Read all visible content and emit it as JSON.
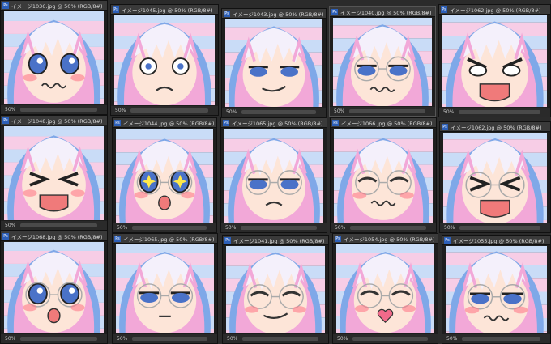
{
  "app": {
    "name": "image editor workspace"
  },
  "windows": [
    {
      "title": "イメージ1036.jpg @ 50% (RGB/8#)",
      "zoom": "50%",
      "expression": "flustered-crying",
      "active": false
    },
    {
      "title": "イメージ1045.jpg @ 50% (RGB/8#)",
      "zoom": "50%",
      "expression": "shocked",
      "active": false
    },
    {
      "title": "イメージ1043.jpg @ 50% (RGB/8#)",
      "zoom": "50%",
      "expression": "smug",
      "active": false
    },
    {
      "title": "イメージ1040.jpg @ 50% (RGB/8#)",
      "zoom": "50%",
      "expression": "nervous",
      "active": true
    },
    {
      "title": "イメージ1062.jpg @ 50% (RGB/8#)",
      "zoom": "50%",
      "expression": "angry",
      "active": false
    },
    {
      "title": "イメージ1048.jpg @ 50% (RGB/8#)",
      "zoom": "50%",
      "expression": "embarrassed-shout",
      "active": false
    },
    {
      "title": "イメージ1044.jpg @ 50% (RGB/8#)",
      "zoom": "50%",
      "expression": "sparkle-eyes",
      "active": false
    },
    {
      "title": "イメージ1065.jpg @ 50% (RGB/8#)",
      "zoom": "50%",
      "expression": "annoyed",
      "active": false
    },
    {
      "title": "イメージ1066.jpg @ 50% (RGB/8#)",
      "zoom": "50%",
      "expression": "cringe",
      "active": false
    },
    {
      "title": "イメージ1062.jpg @ 50% (RGB/8#)",
      "zoom": "50%",
      "expression": "laughing",
      "active": false
    },
    {
      "title": "イメージ1068.jpg @ 50% (RGB/8#)",
      "zoom": "50%",
      "expression": "surprised",
      "active": false
    },
    {
      "title": "イメージ1065.jpg @ 50% (RGB/8#)",
      "zoom": "50%",
      "expression": "unimpressed",
      "active": false
    },
    {
      "title": "イメージ1041.jpg @ 50% (RGB/8#)",
      "zoom": "50%",
      "expression": "squinting",
      "active": false
    },
    {
      "title": "イメージ1054.jpg @ 50% (RGB/8#)",
      "zoom": "50%",
      "expression": "blushing-heart",
      "active": false
    },
    {
      "title": "イメージ1055.jpg @ 50% (RGB/8#)",
      "zoom": "50%",
      "expression": "flustered-blush",
      "active": false
    }
  ],
  "colors": {
    "hair_pink": "#f2a8d8",
    "hair_white": "#f4f0fb",
    "hair_blue": "#7fa8e8",
    "skin": "#fde5d8",
    "eye_blue": "#4a72c8",
    "blush": "#ff7a8a",
    "background_stripes": [
      "#c9dcf7",
      "#f7cde6"
    ],
    "app_bg": "#2b2b2b",
    "tab_bg": "#3a3a3a"
  }
}
